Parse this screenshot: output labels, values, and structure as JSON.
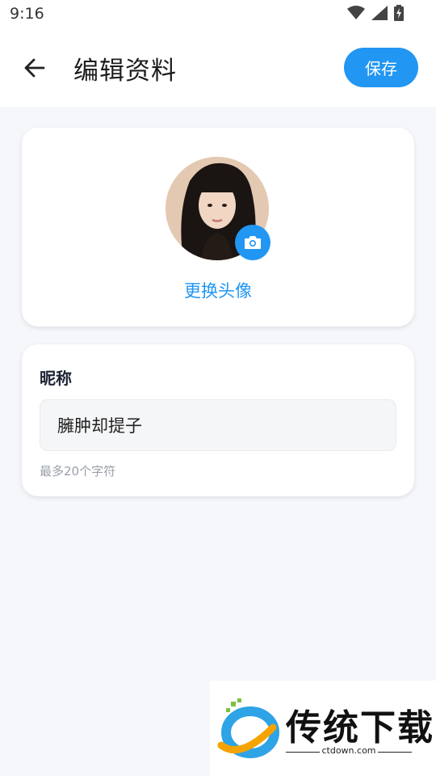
{
  "status_bar": {
    "time": "9:16"
  },
  "header": {
    "title": "编辑资料",
    "save_label": "保存"
  },
  "avatar_section": {
    "change_label": "更换头像"
  },
  "nickname": {
    "label": "昵称",
    "value": "臃肿却提子",
    "hint": "最多20个字符"
  },
  "watermark": {
    "text": "传统下载",
    "url": "ctdown.com"
  },
  "colors": {
    "accent": "#2196f3",
    "background": "#f5f7fb",
    "card": "#ffffff"
  },
  "icons": {
    "back": "arrow-left-icon",
    "camera": "camera-icon",
    "wifi": "wifi-icon",
    "signal": "signal-icon",
    "battery": "battery-charging-icon"
  }
}
